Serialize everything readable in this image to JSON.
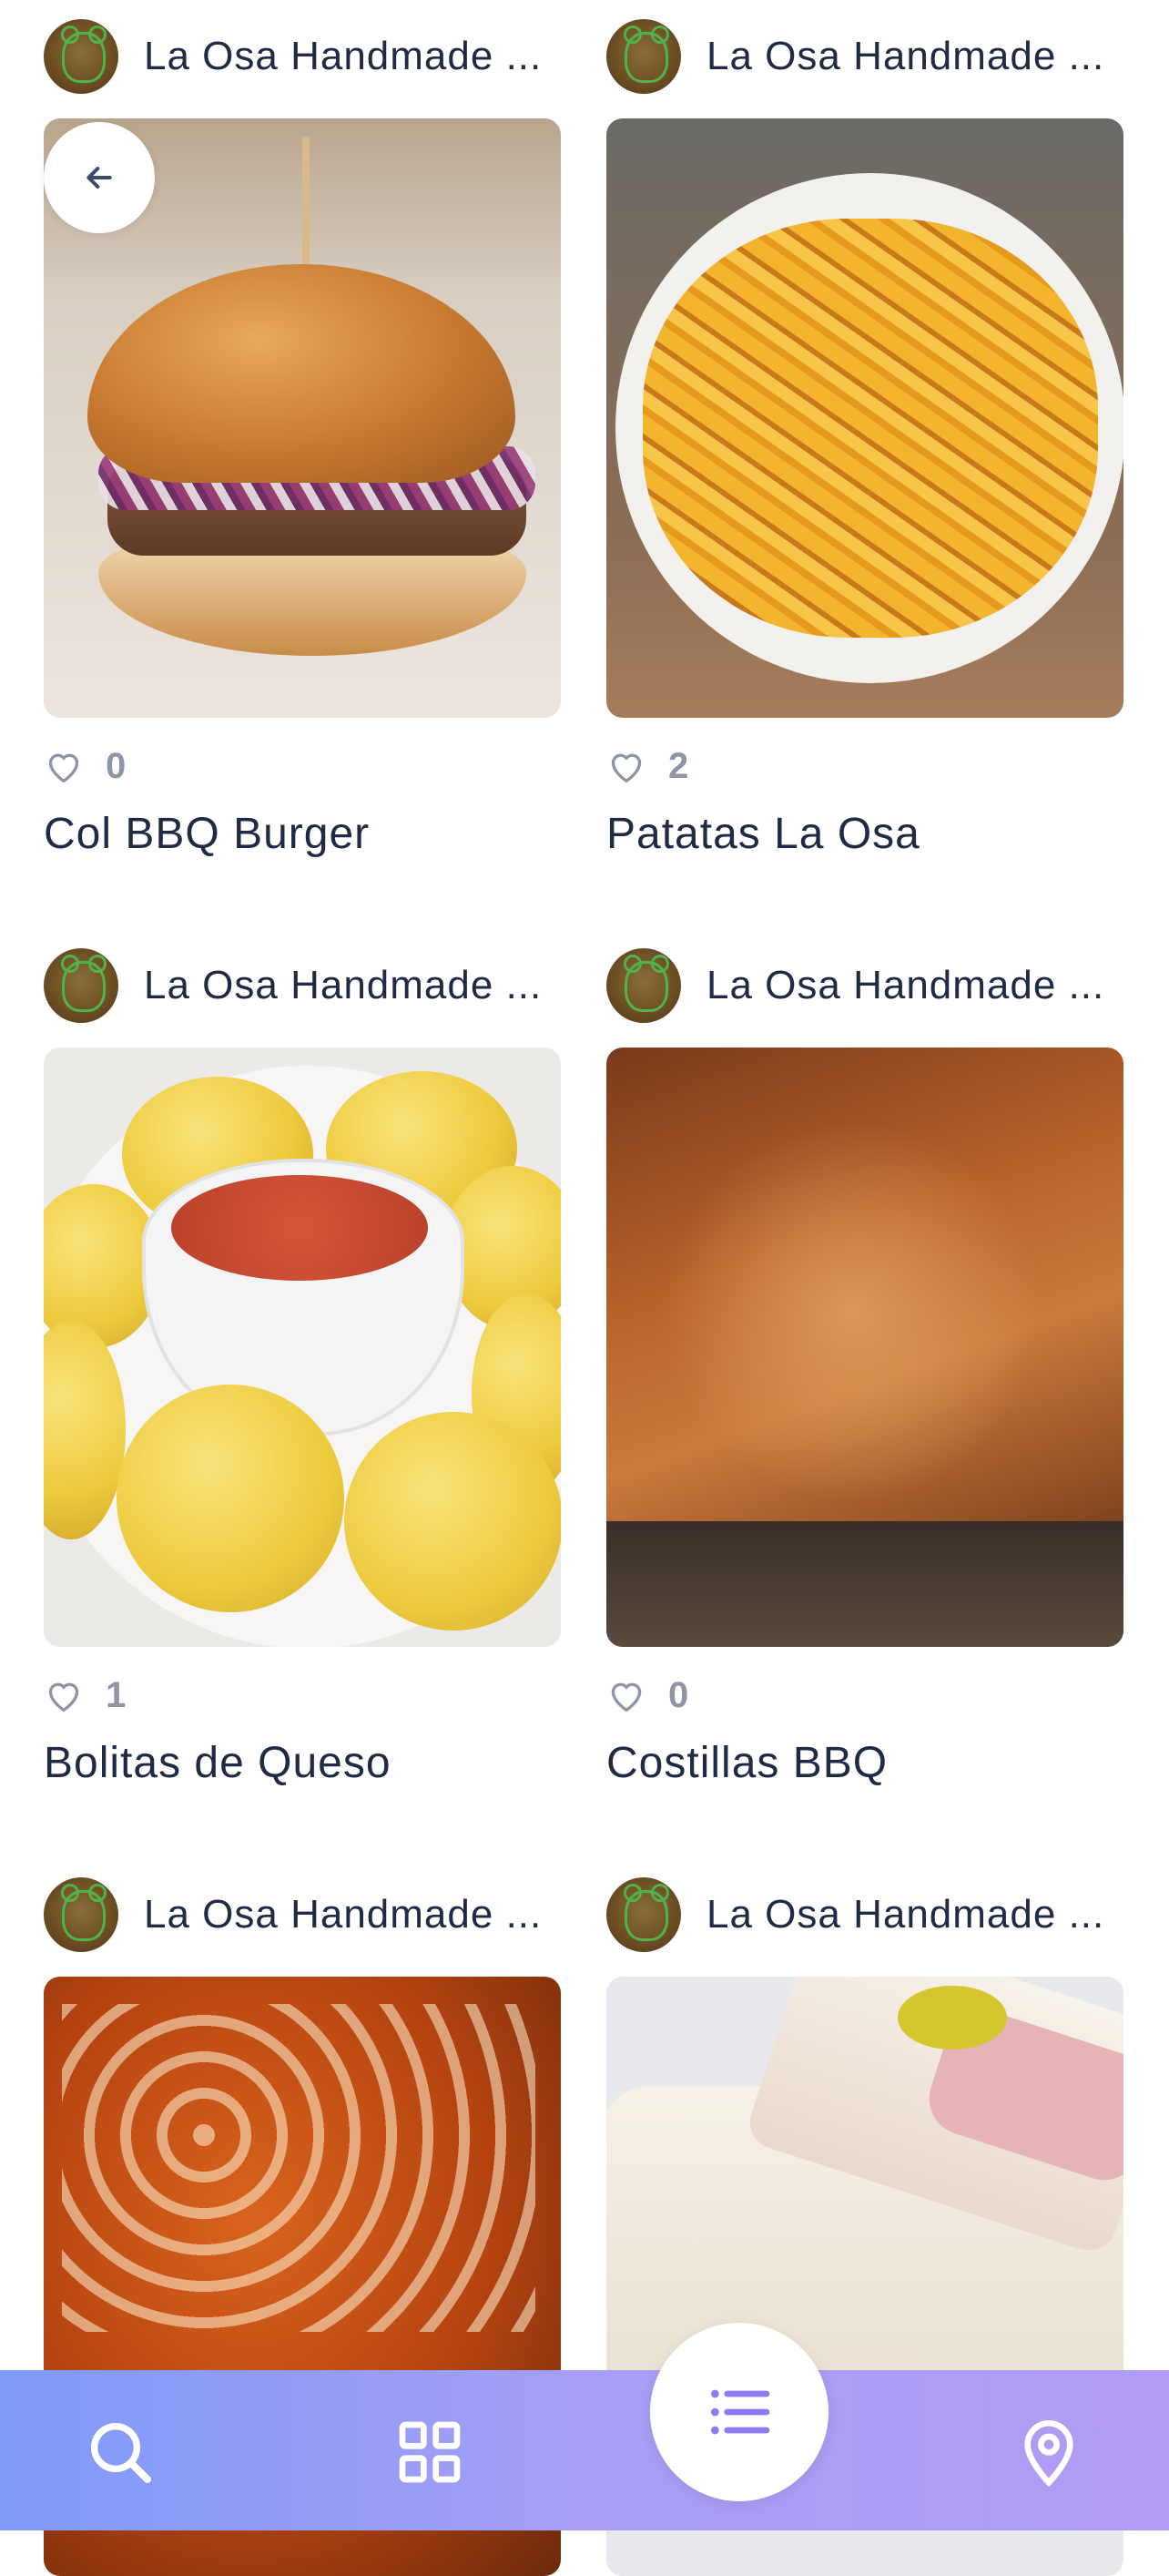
{
  "colors": {
    "text_primary": "#1f2a44",
    "like_count": "#8e95a6",
    "nav_gradient_start": "#7e9bf7",
    "nav_gradient_end": "#b29bf4",
    "fab_icon": "#8b7cf5"
  },
  "items": [
    {
      "shop": "La Osa Handmade ...",
      "likes": "0",
      "title": "Col BBQ Burger",
      "image": "burger"
    },
    {
      "shop": "La Osa Handmade ...",
      "likes": "2",
      "title": "Patatas La Osa",
      "image": "fries"
    },
    {
      "shop": "La Osa Handmade ...",
      "likes": "1",
      "title": "Bolitas de Queso",
      "image": "bolitas"
    },
    {
      "shop": "La Osa Handmade ...",
      "likes": "0",
      "title": "Costillas BBQ",
      "image": "ribs"
    },
    {
      "shop": "La Osa Handmade ...",
      "image": "nachos"
    },
    {
      "shop": "La Osa Handmade ...",
      "image": "sandwich"
    }
  ],
  "icons": {
    "back": "arrow-left-icon",
    "like": "heart-icon",
    "nav_search": "search-icon",
    "nav_grid": "grid-icon",
    "nav_list": "list-icon",
    "nav_location": "location-pin-icon"
  }
}
